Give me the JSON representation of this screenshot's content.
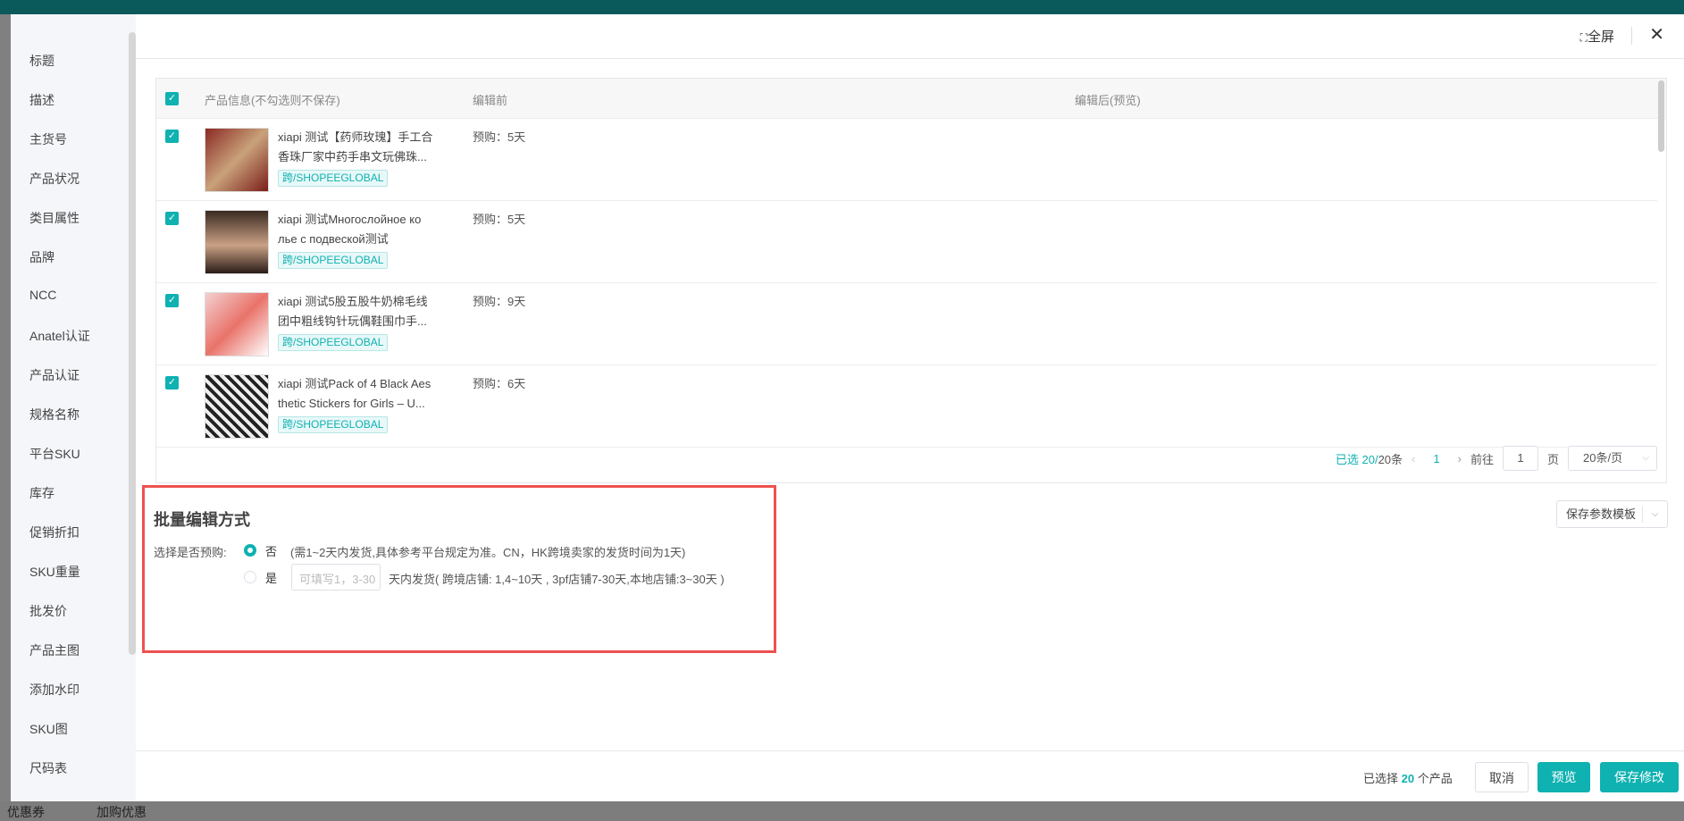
{
  "background": {
    "bottom_left": [
      "优惠券",
      "加购优惠"
    ]
  },
  "sidebar": {
    "items": [
      "标题",
      "描述",
      "主货号",
      "产品状况",
      "类目属性",
      "品牌",
      "NCC",
      "Anatel认证",
      "产品认证",
      "规格名称",
      "平台SKU",
      "库存",
      "促销折扣",
      "SKU重量",
      "批发价",
      "产品主图",
      "添加水印",
      "SKU图",
      "尺码表"
    ]
  },
  "header": {
    "fullscreen_label": "全屏",
    "close_icon": "close-icon"
  },
  "table": {
    "columns": [
      "产品信息(不勾选则不保存)",
      "编辑前",
      "编辑后(预览)"
    ],
    "rows": [
      {
        "name_line1": "xiapi 测试【药师玫瑰】手工合",
        "name_line2": "香珠厂家中药手串文玩佛珠...",
        "tag": "跨/SHOPEEGLOBAL",
        "before": "预购：5天",
        "after": ""
      },
      {
        "name_line1": "xiapi 测试Многослойное ко",
        "name_line2": "лье с подвеской测试",
        "tag": "跨/SHOPEEGLOBAL",
        "before": "预购：5天",
        "after": ""
      },
      {
        "name_line1": "xiapi 测试5股五股牛奶棉毛线",
        "name_line2": "团中粗线钩针玩偶鞋围巾手...",
        "tag": "跨/SHOPEEGLOBAL",
        "before": "预购：9天",
        "after": ""
      },
      {
        "name_line1": "xiapi 测试Pack of 4 Black Aes",
        "name_line2": "thetic Stickers for Girls – U...",
        "tag": "跨/SHOPEEGLOBAL",
        "before": "预购：6天",
        "after": ""
      }
    ]
  },
  "pagination": {
    "selected_prefix": "已选 20/",
    "total": "20条",
    "current_page": "1",
    "goto_label": "前往",
    "goto_value": "1",
    "page_suffix": "页",
    "page_size": "20条/页"
  },
  "batch": {
    "title": "批量编辑方式",
    "question": "选择是否预购:",
    "option_no": "否",
    "option_no_desc": "(需1~2天内发货,具体参考平台规定为准。CN，HK跨境卖家的发货时间为1天)",
    "option_yes": "是",
    "days_placeholder": "可填写1，3-30",
    "option_yes_desc": "天内发货( 跨境店铺: 1,4~10天 , 3pf店铺7-30天,本地店铺:3~30天 )",
    "selected": "否"
  },
  "template_button": "保存参数模板",
  "footer": {
    "selected_prefix": "已选择",
    "selected_count": "20",
    "selected_suffix": "个产品",
    "cancel": "取消",
    "preview": "预览",
    "save": "保存修改"
  },
  "colors": {
    "accent": "#0fb1b1",
    "highlight_border": "#f05050"
  }
}
